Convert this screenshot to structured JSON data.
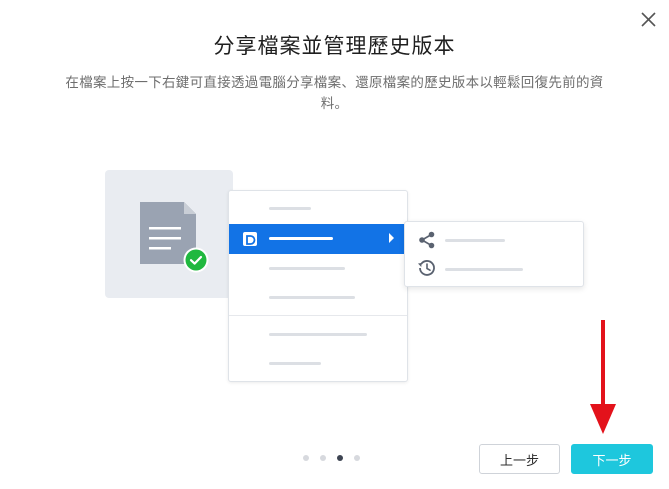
{
  "dialog": {
    "title": "分享檔案並管理歷史版本",
    "subtitle": "在檔案上按一下右鍵可直接透過電腦分享檔案、還原檔案的歷史版本以輕鬆回復先前的資料。"
  },
  "pager": {
    "total": 4,
    "current": 3
  },
  "buttons": {
    "prev_label": "上一步",
    "next_label": "下一步"
  },
  "icons": {
    "close": "close-icon",
    "document": "document-icon",
    "check": "check-badge-icon",
    "share": "share-icon",
    "history": "history-icon",
    "annotation": "red-arrow-down"
  },
  "colors": {
    "accent": "#1ec7dd",
    "menu_highlight": "#1273e6",
    "check_green": "#20b83f",
    "annotation_red": "#e3121b"
  }
}
